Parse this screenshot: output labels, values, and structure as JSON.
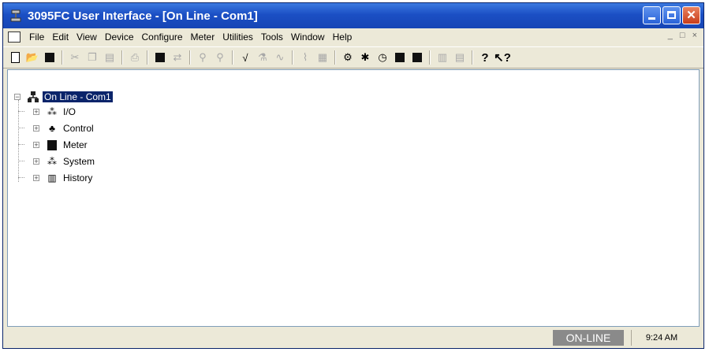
{
  "window": {
    "title": "3095FC User Interface - [On Line - Com1]"
  },
  "menu": {
    "items": [
      "File",
      "Edit",
      "View",
      "Device",
      "Configure",
      "Meter",
      "Utilities",
      "Tools",
      "Window",
      "Help"
    ],
    "mdi_controls": [
      "_",
      "□",
      "×"
    ]
  },
  "toolbar": {
    "icons": [
      "new-icon",
      "open-icon",
      "save-icon",
      "cut-icon",
      "copy-icon",
      "paste-icon",
      "print-icon",
      "connect-icon",
      "disconnect-icon",
      "zoom-in-icon",
      "zoom-out-icon",
      "graph-icon",
      "trend-icon",
      "wave-icon",
      "io-icon",
      "history-icon",
      "config-icon",
      "tag-icon",
      "clock-icon",
      "meter-icon",
      "display-icon",
      "chart-icon",
      "report-icon",
      "help-icon",
      "context-help-icon"
    ]
  },
  "tree": {
    "root": "On Line - Com1",
    "children": [
      "I/O",
      "Control",
      "Meter",
      "System",
      "History"
    ]
  },
  "status": {
    "mode": "ON-LINE",
    "time": "9:24 AM"
  },
  "colors": {
    "titlebar": "#1b4fc4",
    "selection": "#0a246a",
    "status_mode_bg": "#8a8a8a"
  }
}
